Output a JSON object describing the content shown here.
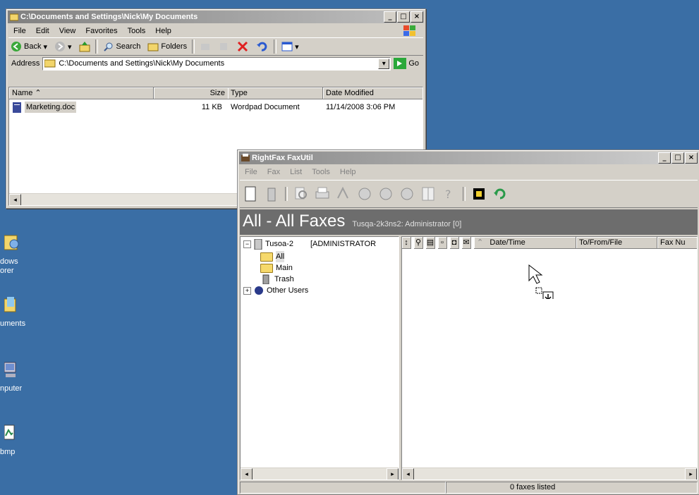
{
  "desktop": {
    "icons": [
      {
        "label": "dows\norer",
        "icon": "windows-explorer-icon"
      },
      {
        "label": "uments",
        "icon": "my-documents-icon"
      },
      {
        "label": "nputer",
        "icon": "my-computer-icon"
      },
      {
        "label": "bmp",
        "icon": "bitmap-icon"
      }
    ]
  },
  "explorer": {
    "title": "C:\\Documents and Settings\\Nick\\My Documents",
    "menu": [
      "File",
      "Edit",
      "View",
      "Favorites",
      "Tools",
      "Help"
    ],
    "toolbar": {
      "back": "Back",
      "search": "Search",
      "folders": "Folders"
    },
    "address": {
      "label": "Address",
      "value": "C:\\Documents and Settings\\Nick\\My Documents",
      "go": "Go"
    },
    "columns": [
      "Name",
      "Size",
      "Type",
      "Date Modified"
    ],
    "files": [
      {
        "name": "Marketing.doc",
        "size": "11 KB",
        "type": "Wordpad Document",
        "modified": "11/14/2008 3:06 PM"
      }
    ]
  },
  "faxutil": {
    "title": "RightFax FaxUtil",
    "menu": [
      "File",
      "Fax",
      "List",
      "Tools",
      "Help"
    ],
    "header": {
      "main": "All - All Faxes",
      "sub": "Tusqa-2k3ns2: Administrator  [0]"
    },
    "tree": {
      "server": "Tusoa-2",
      "server_role": "[ADMINISTRATOR",
      "folders": [
        "All",
        "Main",
        "Trash"
      ],
      "other": "Other Users"
    },
    "list_columns": [
      "Date/Time",
      "To/From/File",
      "Fax Nu"
    ],
    "status": "0 faxes listed"
  },
  "colors": {
    "desktop": "#3a6ea5",
    "titlebar": "#0a246a",
    "panel_header": "#6d6d6d"
  }
}
